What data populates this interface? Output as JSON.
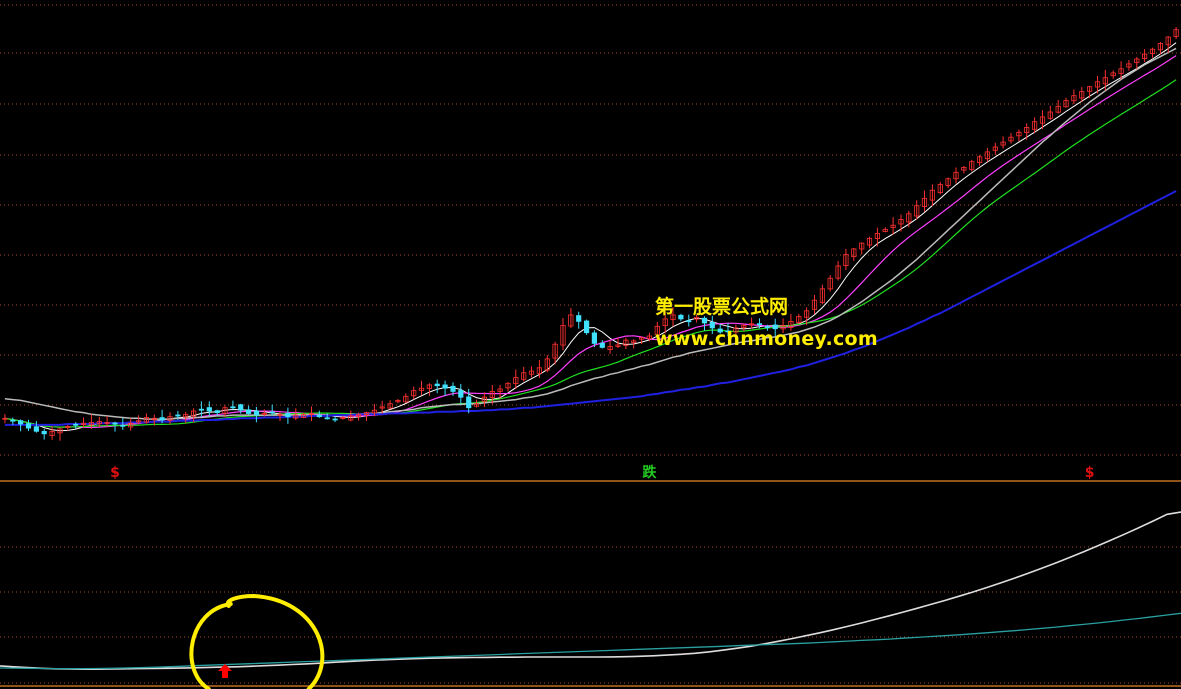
{
  "watermark": {
    "line1": "第一股票公式网",
    "line2": "www.chnmoney.com"
  },
  "markers": [
    {
      "label": "$",
      "x_index": 14,
      "color": "#e01010"
    },
    {
      "label": "跌",
      "x_index": 82,
      "color": "#22cc22"
    },
    {
      "label": "$",
      "x_index": 138,
      "color": "#e01010"
    }
  ],
  "signal_arrow": {
    "name": "buy-arrow-icon",
    "x_index": 28,
    "color": "#ff0000"
  },
  "annotation_circle": {
    "color": "#ffee00",
    "center_x_index": 30
  },
  "chart_data": [
    {
      "type": "candlestick",
      "panel": "price",
      "bars": 150,
      "colors": {
        "up": "#ff3030",
        "down": "#40e0ff",
        "ma_short": "#ffffff",
        "ma_mid": "#ff40ff",
        "ma_long": "#20e020",
        "ma_longer": "#bbbbbb",
        "ma_longest": "#2020e0"
      },
      "close": [
        22.5,
        22.2,
        21.8,
        21.3,
        20.9,
        20.6,
        20.9,
        21.2,
        21.5,
        21.7,
        21.9,
        22.0,
        22.1,
        22.0,
        21.8,
        21.6,
        21.9,
        22.2,
        22.6,
        22.5,
        22.3,
        22.7,
        22.8,
        23.0,
        23.4,
        23.6,
        23.4,
        23.2,
        23.8,
        23.9,
        23.5,
        23.1,
        22.9,
        23.1,
        23.2,
        23.0,
        22.7,
        22.9,
        23.0,
        23.1,
        22.7,
        22.5,
        22.4,
        22.6,
        22.8,
        23.0,
        23.2,
        23.5,
        23.9,
        24.3,
        24.7,
        25.2,
        25.9,
        26.2,
        26.6,
        26.5,
        26.2,
        25.8,
        25.1,
        23.8,
        24.3,
        25.1,
        25.8,
        26.1,
        26.8,
        27.5,
        28.1,
        28.3,
        28.7,
        29.8,
        31.6,
        33.9,
        35.2,
        34.4,
        33.0,
        31.7,
        31.2,
        31.3,
        31.5,
        32.1,
        32.0,
        32.4,
        32.6,
        33.8,
        34.7,
        35.2,
        34.7,
        34.4,
        34.9,
        34.2,
        33.6,
        33.1,
        33.2,
        33.6,
        33.9,
        34.1,
        34.0,
        33.7,
        33.5,
        33.9,
        34.4,
        35.0,
        35.7,
        37.0,
        38.4,
        39.7,
        41.2,
        42.6,
        43.3,
        44.0,
        44.6,
        45.2,
        45.7,
        46.2,
        46.9,
        47.6,
        48.6,
        49.5,
        50.5,
        51.2,
        51.9,
        52.7,
        53.3,
        54.0,
        54.6,
        55.2,
        55.8,
        56.4,
        57.0,
        57.6,
        58.2,
        58.9,
        59.5,
        60.1,
        60.8,
        61.5,
        62.1,
        62.6,
        63.2,
        63.8,
        64.3,
        64.9,
        65.4,
        66.0,
        66.6,
        67.2,
        67.8,
        68.5,
        69.3,
        70.2
      ],
      "ma_longer": [
        24.9,
        24.8,
        24.7,
        24.5,
        24.3,
        24.1,
        23.9,
        23.7,
        23.5,
        23.3,
        23.2,
        23.0,
        22.9,
        22.8,
        22.7,
        22.6,
        22.5,
        22.5,
        22.4,
        22.4,
        22.4,
        22.4,
        22.5,
        22.5,
        22.6,
        22.6,
        22.7,
        22.8,
        22.8,
        22.9,
        22.9,
        22.9,
        22.9,
        22.9,
        22.9,
        22.9,
        22.9,
        22.9,
        22.9,
        22.9,
        22.9,
        22.9,
        22.9,
        22.9,
        23.0,
        23.0,
        23.1,
        23.1,
        23.2,
        23.3,
        23.4,
        23.5,
        23.6,
        23.8,
        23.9,
        24.0,
        24.1,
        24.2,
        24.2,
        24.3,
        24.3,
        24.4,
        24.5,
        24.6,
        24.7,
        24.8,
        25.0,
        25.1,
        25.3,
        25.5,
        25.8,
        26.1,
        26.5,
        26.8,
        27.1,
        27.4,
        27.6,
        27.9,
        28.1,
        28.4,
        28.6,
        28.9,
        29.1,
        29.4,
        29.7,
        30.0,
        30.2,
        30.5,
        30.7,
        30.9,
        31.1,
        31.3,
        31.5,
        31.7,
        31.9,
        32.0,
        32.2,
        32.4,
        32.5,
        32.7,
        32.9,
        33.1,
        33.4,
        33.7,
        34.1,
        34.5,
        35.0,
        35.6,
        36.2,
        36.8,
        37.5,
        38.2,
        38.9,
        39.6,
        40.4,
        41.2,
        42.0,
        42.9,
        43.8,
        44.7,
        45.6,
        46.5,
        47.4,
        48.3,
        49.2,
        50.1,
        51.0,
        51.9,
        52.8,
        53.7,
        54.6,
        55.5,
        56.4,
        57.2,
        58.1,
        58.9,
        59.7,
        60.5,
        61.3,
        62.0,
        62.7,
        63.4,
        64.1,
        64.7,
        65.3,
        65.9,
        66.4,
        66.9,
        67.4,
        67.9
      ],
      "ma_longest": [
        21.7,
        21.7,
        21.7,
        21.7,
        21.7,
        21.7,
        21.7,
        21.7,
        21.8,
        21.8,
        21.8,
        21.8,
        21.9,
        21.9,
        21.9,
        21.9,
        22.0,
        22.0,
        22.0,
        22.1,
        22.1,
        22.1,
        22.2,
        22.2,
        22.2,
        22.3,
        22.3,
        22.3,
        22.4,
        22.4,
        22.5,
        22.5,
        22.5,
        22.6,
        22.6,
        22.6,
        22.7,
        22.7,
        22.7,
        22.8,
        22.8,
        22.8,
        22.9,
        22.9,
        22.9,
        23.0,
        23.0,
        23.0,
        23.0,
        23.1,
        23.1,
        23.1,
        23.2,
        23.2,
        23.2,
        23.3,
        23.3,
        23.3,
        23.4,
        23.4,
        23.4,
        23.5,
        23.5,
        23.6,
        23.6,
        23.7,
        23.8,
        23.8,
        23.9,
        24.0,
        24.1,
        24.2,
        24.3,
        24.4,
        24.5,
        24.6,
        24.7,
        24.8,
        24.9,
        25.0,
        25.1,
        25.2,
        25.4,
        25.5,
        25.7,
        25.8,
        26.0,
        26.1,
        26.3,
        26.4,
        26.6,
        26.8,
        26.9,
        27.1,
        27.3,
        27.5,
        27.7,
        27.9,
        28.1,
        28.3,
        28.5,
        28.8,
        29.0,
        29.3,
        29.6,
        29.9,
        30.2,
        30.5,
        30.9,
        31.2,
        31.6,
        32.0,
        32.4,
        32.8,
        33.2,
        33.6,
        34.1,
        34.5,
        35.0,
        35.4,
        35.9,
        36.4,
        36.9,
        37.4,
        37.9,
        38.4,
        38.9,
        39.4,
        39.9,
        40.4,
        40.9,
        41.4,
        41.9,
        42.4,
        42.9,
        43.4,
        43.9,
        44.4,
        44.9,
        45.4,
        45.9,
        46.4,
        46.9,
        47.4,
        47.9,
        48.4,
        48.9,
        49.4,
        49.9,
        50.4
      ]
    },
    {
      "type": "line",
      "panel": "indicator",
      "series": [
        {
          "color": "#dddddd",
          "values": [
            10,
            9.5,
            9,
            8.6,
            8.3,
            8.2,
            8.1,
            8.1,
            8.2,
            8.3,
            8.4,
            8.5,
            8.6,
            8.7,
            8.9,
            9.1,
            9.3,
            9.5,
            9.8,
            10.1,
            10.4,
            10.8,
            11.2,
            11.6,
            12.1,
            12.5,
            13,
            13.4,
            13.7,
            14,
            14.3,
            14.5,
            14.7,
            14.8,
            14.9,
            15,
            15.1,
            15.1,
            15.2,
            15.2,
            15.2,
            15.2,
            15.2,
            15.2,
            15.3,
            15.4,
            15.6,
            15.9,
            16.3,
            16.8,
            17.4,
            18.2,
            19.2,
            20.3,
            21.5,
            22.9,
            24.4,
            26,
            27.7,
            29.4,
            31.2,
            33.1,
            35.1,
            37.2,
            39.3,
            41.5,
            43.7,
            46,
            48.3,
            50.7,
            53.2,
            55.8,
            58.5,
            61.3,
            64.2,
            67.2,
            70.3,
            73.5,
            76.8,
            80.2,
            83.7,
            87.3,
            91,
            94.8,
            98.7,
            100
          ]
        },
        {
          "color": "#2a9f9f",
          "values": [
            8.8,
            8.7,
            8.6,
            8.5,
            8.4,
            8.4,
            8.4,
            8.5,
            8.6,
            8.8,
            9,
            9.2,
            9.5,
            9.8,
            10.1,
            10.4,
            10.7,
            11,
            11.3,
            11.6,
            11.9,
            12.2,
            12.5,
            12.8,
            13.1,
            13.4,
            13.7,
            14,
            14.3,
            14.6,
            14.9,
            15.2,
            15.5,
            15.8,
            16.1,
            16.4,
            16.7,
            17,
            17.3,
            17.6,
            17.9,
            18.2,
            18.5,
            18.8,
            19.1,
            19.4,
            19.7,
            20,
            20.3,
            20.6,
            20.9,
            21.2,
            21.5,
            21.8,
            22.1,
            22.4,
            22.7,
            23,
            23.3,
            23.7,
            24.1,
            24.5,
            24.9,
            25.3,
            25.7,
            26.2,
            26.7,
            27.2,
            27.7,
            28.2,
            28.8,
            29.4,
            30,
            30.6,
            31.3,
            32,
            32.7,
            33.5,
            34.3,
            35.1,
            36,
            36.9,
            37.8,
            38.8,
            39.8,
            40.8
          ]
        }
      ]
    }
  ]
}
